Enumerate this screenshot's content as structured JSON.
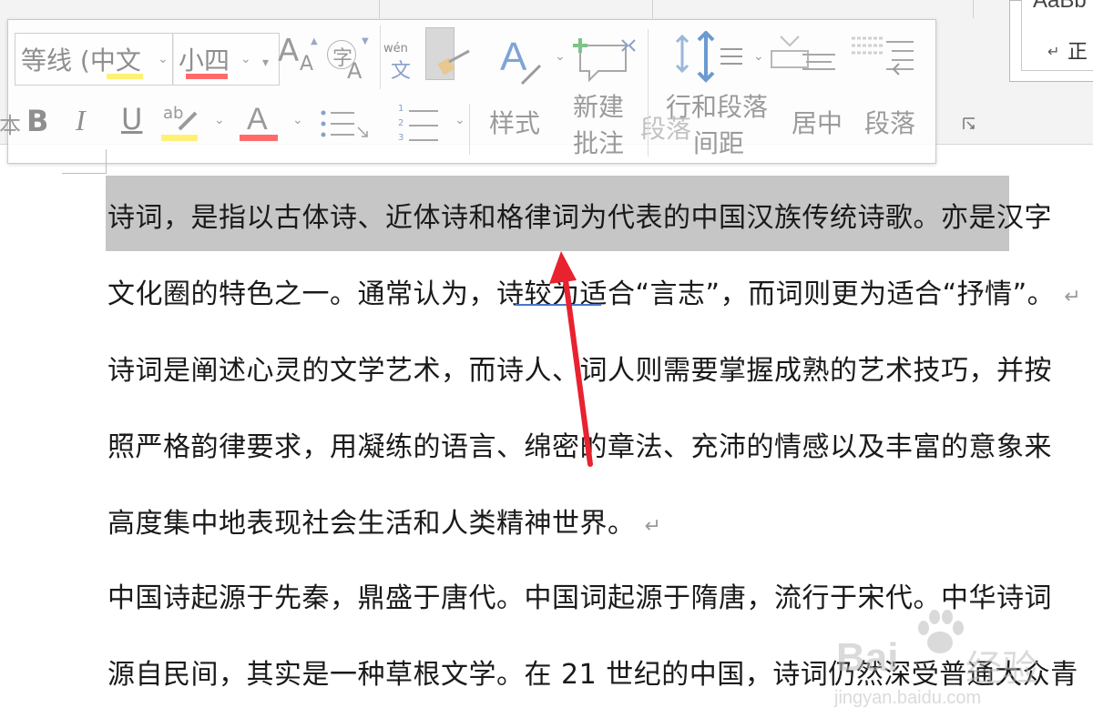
{
  "ribbon": {
    "styles_gallery_text": "AaBb",
    "styles_gallery_label": "正",
    "para_mark": "↵"
  },
  "mini_toolbar": {
    "font_name": "等线 (中文",
    "font_size": "小四",
    "grow_font": "A",
    "shrink_font": "A",
    "phonetic_char": "字",
    "phonetic_guide_top": "wén",
    "phonetic_guide_bottom": "文",
    "bold": "B",
    "italic": "I",
    "underline": "U",
    "highlight_ab": "ab",
    "font_color_a": "A",
    "cut_left_char": "本",
    "styles_label": "样式",
    "new_comment_line1": "新建",
    "new_comment_line2": "批注",
    "paragraph_ghost": "段落",
    "line_spacing_line1": "行和段落",
    "line_spacing_line2": "间距",
    "center_label": "居中",
    "paragraph_label": "段落",
    "numbering": [
      "1",
      "2",
      "3"
    ]
  },
  "document": {
    "lines": [
      "诗词，是指以古体诗、近体诗和格律词为代表的中国汉族传统诗歌。亦是汉字",
      "文化圈的特色之一。通常认为，诗较为适合“言志”，而词则更为适合“抒情”。",
      "诗词是阐述心灵的文学艺术，而诗人、词人则需要掌握成熟的艺术技巧，并按",
      "照严格韵律要求，用凝练的语言、绵密的章法、充沛的情感以及丰富的意象来",
      "高度集中地表现社会生活和人类精神世界。",
      "中国诗起源于先秦，鼎盛于唐代。中国词起源于隋唐，流行于宋代。中华诗词",
      "源自民间，其实是一种草根文学。在 21 世纪的中国，诗词仍然深受普通大众青"
    ],
    "para_mark": "↵"
  },
  "watermark": {
    "brand": "Bai",
    "brand_suffix": "经验",
    "url": "jingyan.baidu.com"
  },
  "colors": {
    "highlight": "#fff176",
    "font_color": "#ff6b6b",
    "selection": "#c6c6c6",
    "arrow": "#e8222f"
  }
}
